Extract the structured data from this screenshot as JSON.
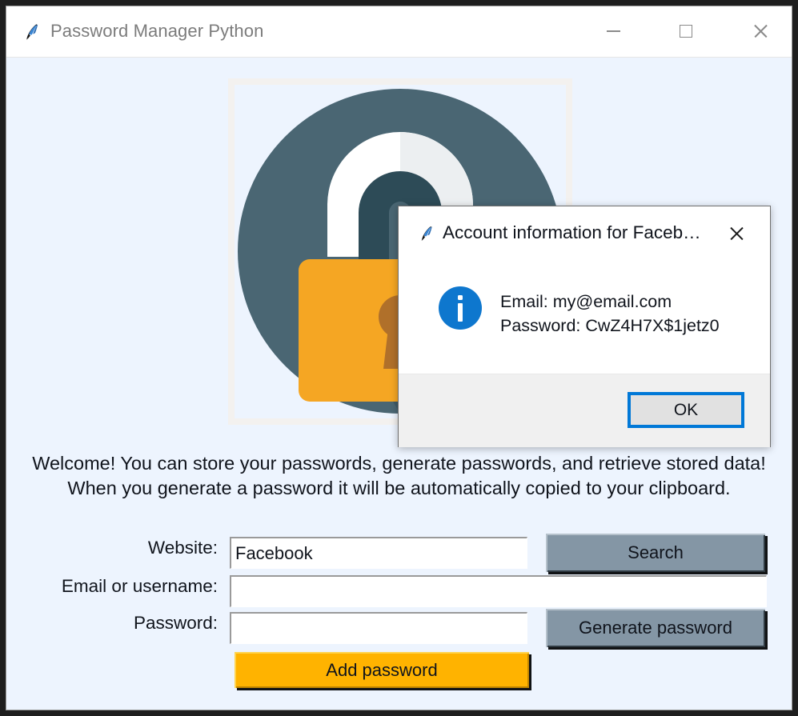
{
  "window": {
    "title": "Password Manager Python",
    "icon": "python-feather-icon",
    "controls": {
      "minimize": "minimize-button",
      "maximize": "maximize-button",
      "close": "close-button"
    }
  },
  "logo": {
    "name": "padlock-logo",
    "colors": {
      "circle": "#4a6673",
      "circle_shadow": "#3c5561",
      "shackle_outer": "#ffffff",
      "shackle_inner": "#2d4b57",
      "body": "#f5a623",
      "body_shade": "#e2951a",
      "keyhole": "#b0702a",
      "canvas_border": "#f3f1ef"
    }
  },
  "welcome": {
    "line1": "Welcome! You can store your passwords, generate passwords, and retrieve stored data!",
    "line2": "When you generate a password it will be automatically copied to your clipboard."
  },
  "form": {
    "website": {
      "label": "Website:",
      "value": "Facebook",
      "placeholder": ""
    },
    "email": {
      "label": "Email or username:",
      "value": "",
      "placeholder": ""
    },
    "password": {
      "label": "Password:",
      "value": "",
      "placeholder": ""
    },
    "buttons": {
      "search": "Search",
      "generate": "Generate password",
      "add": "Add password"
    },
    "colors": {
      "button_gray": "#8496a5",
      "button_orange": "#ffb300",
      "page_background": "#edf4fe"
    }
  },
  "dialog": {
    "title": "Account information for Faceb…",
    "icon": "python-feather-icon",
    "close_label": "close-icon",
    "info_icon": "information-icon",
    "message_line1": "Email: my@email.com",
    "message_line2": "Password: CwZ4H7X$1jetz0",
    "ok_label": "OK",
    "colors": {
      "info_blue": "#0e77ce",
      "focus_border": "#0078d7",
      "footer": "#f0f0f0",
      "button_face": "#e1e1e1"
    }
  }
}
